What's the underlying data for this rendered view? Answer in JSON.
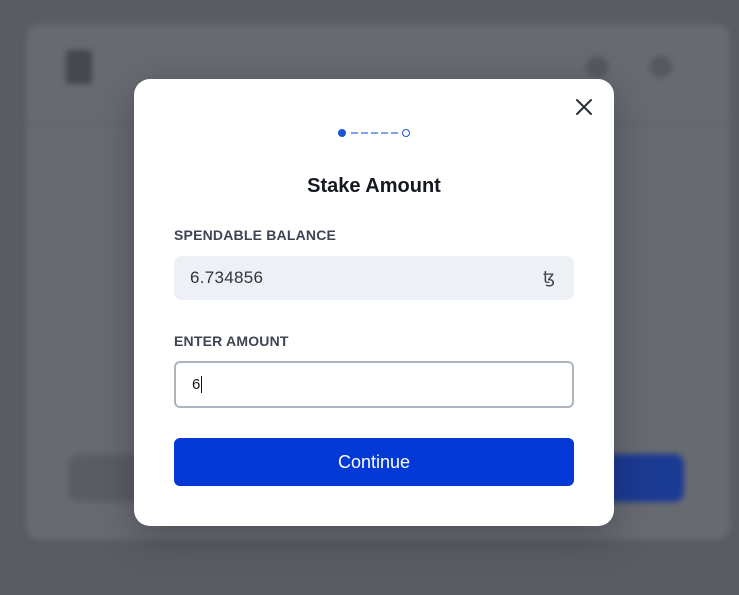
{
  "modal": {
    "title": "Stake Amount",
    "close_icon": "close-icon",
    "stepper": {
      "total_steps": 2,
      "current_step": 1
    },
    "balance": {
      "label": "SPENDABLE BALANCE",
      "value": "6.734856",
      "currency_symbol": "ꜩ",
      "currency_icon": "tez-icon"
    },
    "amount": {
      "label": "ENTER AMOUNT",
      "value": "6"
    },
    "continue_label": "Continue"
  },
  "colors": {
    "primary": "#0439d8",
    "step_active": "#1a56db",
    "overlay": "#595c63",
    "balance_bg": "#edf0f4"
  }
}
